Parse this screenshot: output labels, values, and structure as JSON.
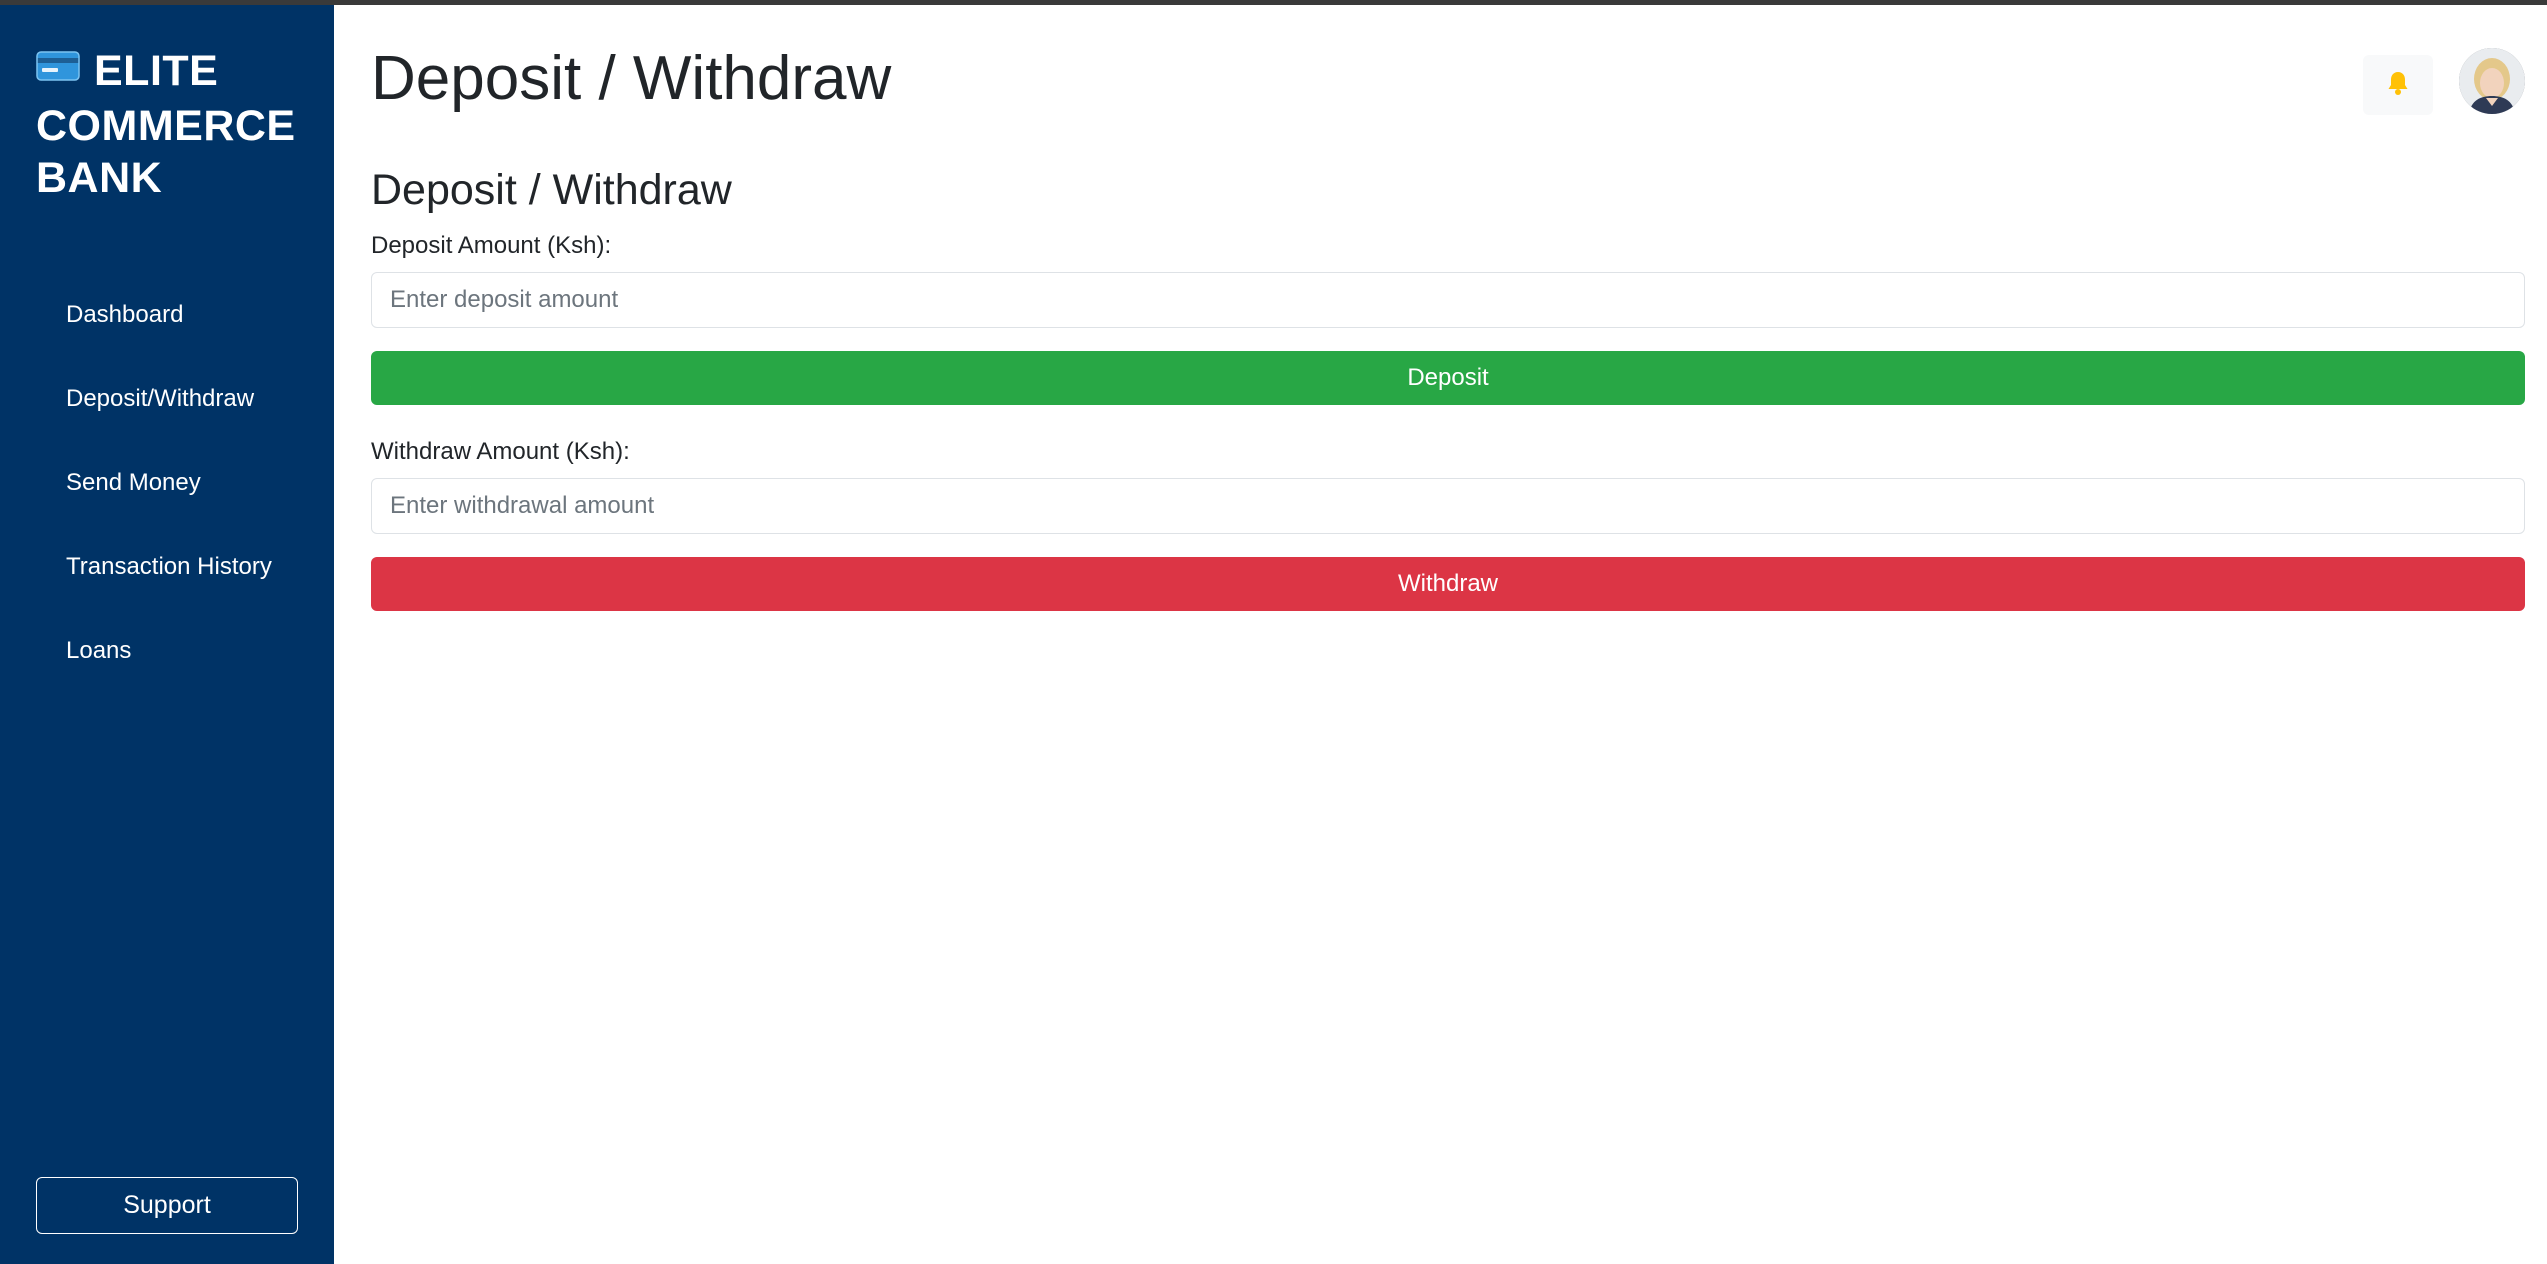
{
  "brand": {
    "line1": "ELITE",
    "line2": "COMMERCE",
    "line3": "BANK",
    "icon": "credit-card-icon"
  },
  "sidebar": {
    "items": [
      {
        "label": "Dashboard"
      },
      {
        "label": "Deposit/Withdraw"
      },
      {
        "label": "Send Money"
      },
      {
        "label": "Transaction History"
      },
      {
        "label": "Loans"
      }
    ],
    "support_label": "Support"
  },
  "header": {
    "title": "Deposit / Withdraw",
    "notification_icon": "bell-icon",
    "avatar_icon": "user-avatar"
  },
  "main": {
    "section_title": "Deposit / Withdraw",
    "deposit": {
      "label": "Deposit Amount (Ksh):",
      "placeholder": "Enter deposit amount",
      "button_label": "Deposit"
    },
    "withdraw": {
      "label": "Withdraw Amount (Ksh):",
      "placeholder": "Enter withdrawal amount",
      "button_label": "Withdraw"
    }
  },
  "colors": {
    "sidebar_bg": "#003366",
    "deposit_button": "#28a745",
    "withdraw_button": "#dc3545",
    "bell": "#ffc107"
  }
}
